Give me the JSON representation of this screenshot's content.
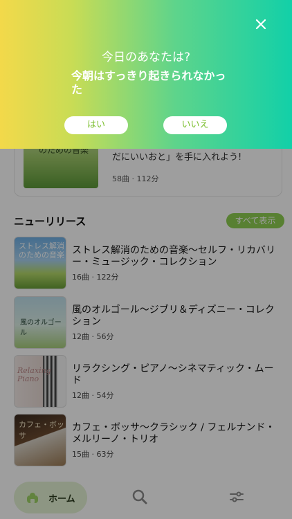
{
  "popup": {
    "title": "今日のあなたは?",
    "question": "今朝はすっきり起きられなかった",
    "yes_label": "はい",
    "no_label": "いいえ"
  },
  "featured": {
    "thumb_text": "のための音楽",
    "description": "だにいいおと」を手に入れよう!",
    "track_count": "58曲",
    "duration": "112分"
  },
  "new_releases": {
    "title": "ニューリリース",
    "see_all_label": "すべて表示",
    "items": [
      {
        "title": "ストレス解消のための音楽～セルフ・リカバリー・ミュージック・コレクション",
        "tracks": "16曲",
        "duration": "122分",
        "art_text": "ストレス解消のための音楽"
      },
      {
        "title": "風のオルゴール～ジブリ＆ディズニー・コレクション",
        "tracks": "12曲",
        "duration": "56分",
        "art_text": "風のオルゴール"
      },
      {
        "title": "リラクシング・ピアノ～シネマティック・ムード",
        "tracks": "12曲",
        "duration": "54分",
        "art_text": "Relaxing Piano"
      },
      {
        "title": "カフェ・ボッサ～クラシック / フェルナンド・メルリーノ・トリオ",
        "tracks": "15曲",
        "duration": "63分",
        "art_text": "カフェ・ボッサ"
      }
    ]
  },
  "tabbar": {
    "home_label": "ホーム"
  },
  "icons": {
    "close": "close-icon",
    "home": "home-icon",
    "search": "search-icon",
    "settings": "sliders-icon"
  },
  "colors": {
    "accent": "#8fcf52",
    "gradient_start": "#f3d94a",
    "gradient_end": "#12d0a8"
  }
}
